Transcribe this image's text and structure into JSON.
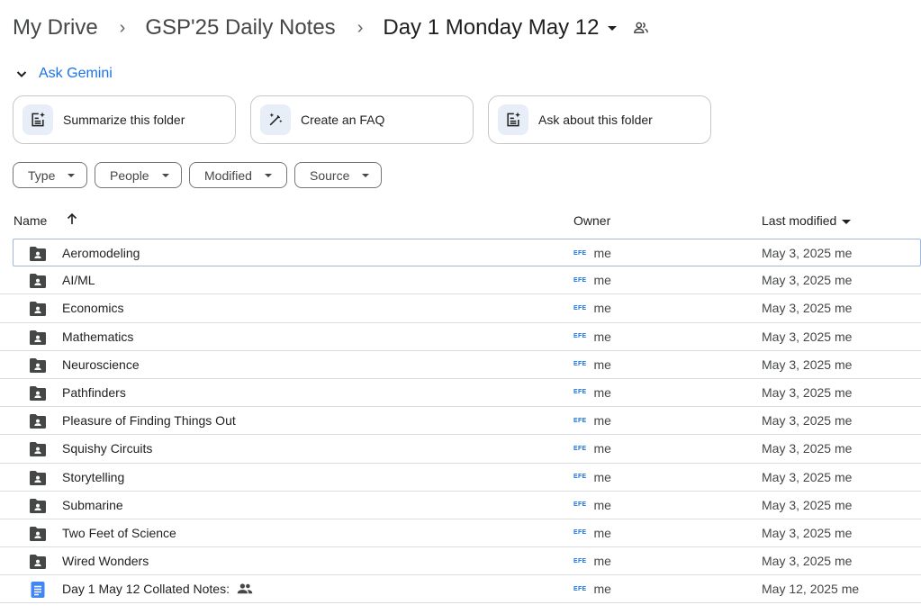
{
  "breadcrumb": {
    "items": [
      "My Drive",
      "GSP'25 Daily Notes",
      "Day 1 Monday May 12"
    ],
    "separator": ">",
    "current_icon": "shared-people-icon"
  },
  "gemini": {
    "label": "Ask Gemini",
    "suggestions": [
      {
        "label": "Summarize this folder",
        "icon": "summarize-sparkle-icon"
      },
      {
        "label": "Create an FAQ",
        "icon": "magic-pen-icon"
      },
      {
        "label": "Ask about this folder",
        "icon": "ask-sparkle-icon"
      }
    ]
  },
  "filters": [
    "Type",
    "People",
    "Modified",
    "Source"
  ],
  "table": {
    "headers": {
      "name": "Name",
      "owner": "Owner",
      "modified": "Last modified"
    },
    "sort": {
      "column": "Name",
      "direction": "ascending"
    },
    "rows": [
      {
        "name": "Aeromodeling",
        "type": "shared-folder",
        "owner_avatar": "EFE",
        "owner": "me",
        "modified": "May 3, 2025",
        "modified_by": "me"
      },
      {
        "name": "AI/ML",
        "type": "shared-folder",
        "owner_avatar": "EFE",
        "owner": "me",
        "modified": "May 3, 2025",
        "modified_by": "me"
      },
      {
        "name": "Economics",
        "type": "shared-folder",
        "owner_avatar": "EFE",
        "owner": "me",
        "modified": "May 3, 2025",
        "modified_by": "me"
      },
      {
        "name": "Mathematics",
        "type": "shared-folder",
        "owner_avatar": "EFE",
        "owner": "me",
        "modified": "May 3, 2025",
        "modified_by": "me"
      },
      {
        "name": "Neuroscience",
        "type": "shared-folder",
        "owner_avatar": "EFE",
        "owner": "me",
        "modified": "May 3, 2025",
        "modified_by": "me"
      },
      {
        "name": "Pathfinders",
        "type": "shared-folder",
        "owner_avatar": "EFE",
        "owner": "me",
        "modified": "May 3, 2025",
        "modified_by": "me"
      },
      {
        "name": "Pleasure of Finding Things Out",
        "type": "shared-folder",
        "owner_avatar": "EFE",
        "owner": "me",
        "modified": "May 3, 2025",
        "modified_by": "me"
      },
      {
        "name": "Squishy Circuits",
        "type": "shared-folder",
        "owner_avatar": "EFE",
        "owner": "me",
        "modified": "May 3, 2025",
        "modified_by": "me"
      },
      {
        "name": "Storytelling",
        "type": "shared-folder",
        "owner_avatar": "EFE",
        "owner": "me",
        "modified": "May 3, 2025",
        "modified_by": "me"
      },
      {
        "name": "Submarine",
        "type": "shared-folder",
        "owner_avatar": "EFE",
        "owner": "me",
        "modified": "May 3, 2025",
        "modified_by": "me"
      },
      {
        "name": "Two Feet of Science",
        "type": "shared-folder",
        "owner_avatar": "EFE",
        "owner": "me",
        "modified": "May 3, 2025",
        "modified_by": "me"
      },
      {
        "name": "Wired Wonders",
        "type": "shared-folder",
        "owner_avatar": "EFE",
        "owner": "me",
        "modified": "May 3, 2025",
        "modified_by": "me"
      },
      {
        "name": "Day 1  May 12 Collated Notes:",
        "type": "google-doc",
        "shared": true,
        "owner_avatar": "EFE",
        "owner": "me",
        "modified": "May 12, 2025",
        "modified_by": "me"
      }
    ]
  },
  "colors": {
    "accent": "#1a73e8",
    "doc_icon": "#4285f4",
    "folder_icon": "#444746",
    "selected_border": "#9fb8db"
  }
}
